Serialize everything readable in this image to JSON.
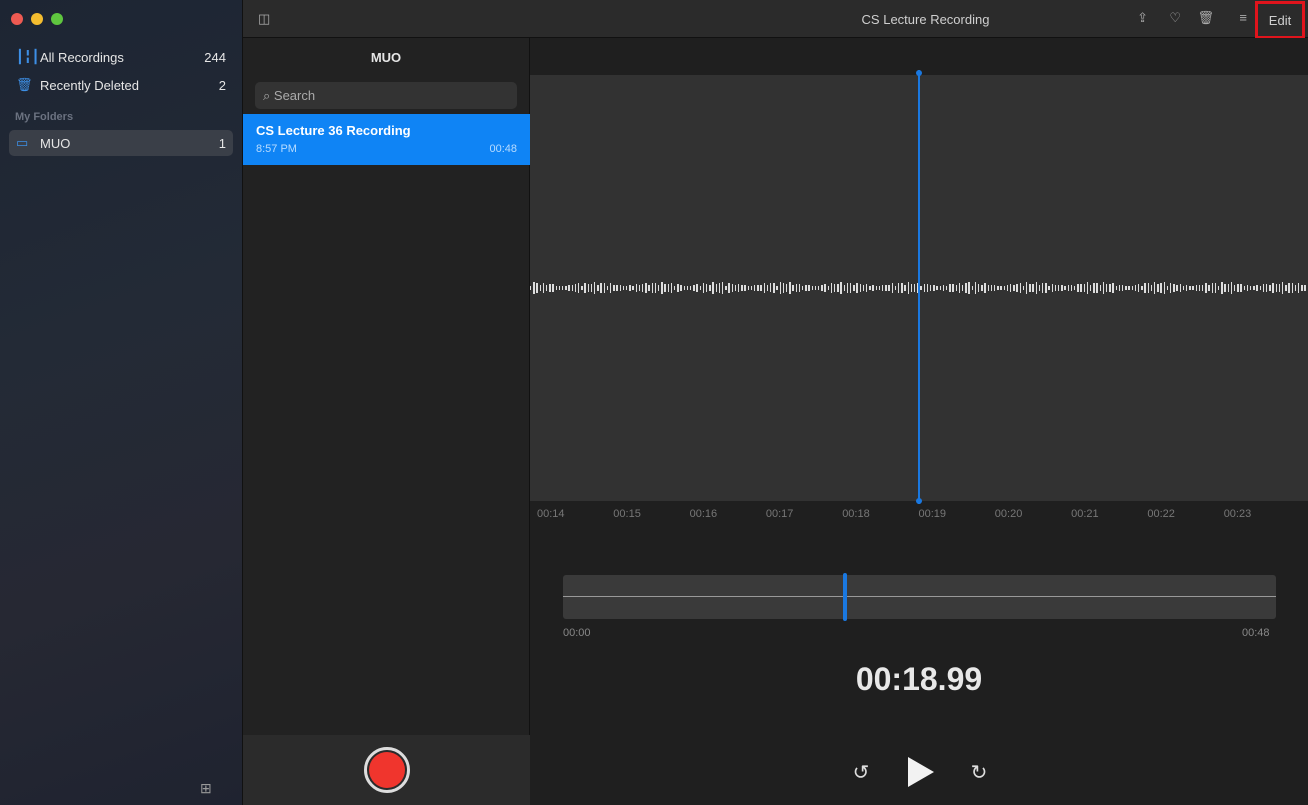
{
  "window": {
    "title": "CS Lecture Recording",
    "edit_label": "Edit"
  },
  "sidebar": {
    "items": [
      {
        "label": "All Recordings",
        "count": "244",
        "icon": "waveform-icon"
      },
      {
        "label": "Recently Deleted",
        "count": "2",
        "icon": "trash-icon"
      }
    ],
    "section": "My Folders",
    "folders": [
      {
        "label": "MUO",
        "count": "1",
        "icon": "folder-icon"
      }
    ]
  },
  "list": {
    "title": "MUO",
    "search_placeholder": "Search",
    "recordings": [
      {
        "title": "CS Lecture 36 Recording",
        "time": "8:57 PM",
        "duration": "00:48"
      }
    ]
  },
  "player": {
    "time_ticks": [
      "00:14",
      "00:15",
      "00:16",
      "00:17",
      "00:18",
      "00:19",
      "00:20",
      "00:21",
      "00:22",
      "00:23"
    ],
    "start": "00:00",
    "end": "00:48",
    "current": "00:18.99",
    "progress": 0.396,
    "accent": "#0f84f5",
    "record_color": "#f0352d"
  }
}
